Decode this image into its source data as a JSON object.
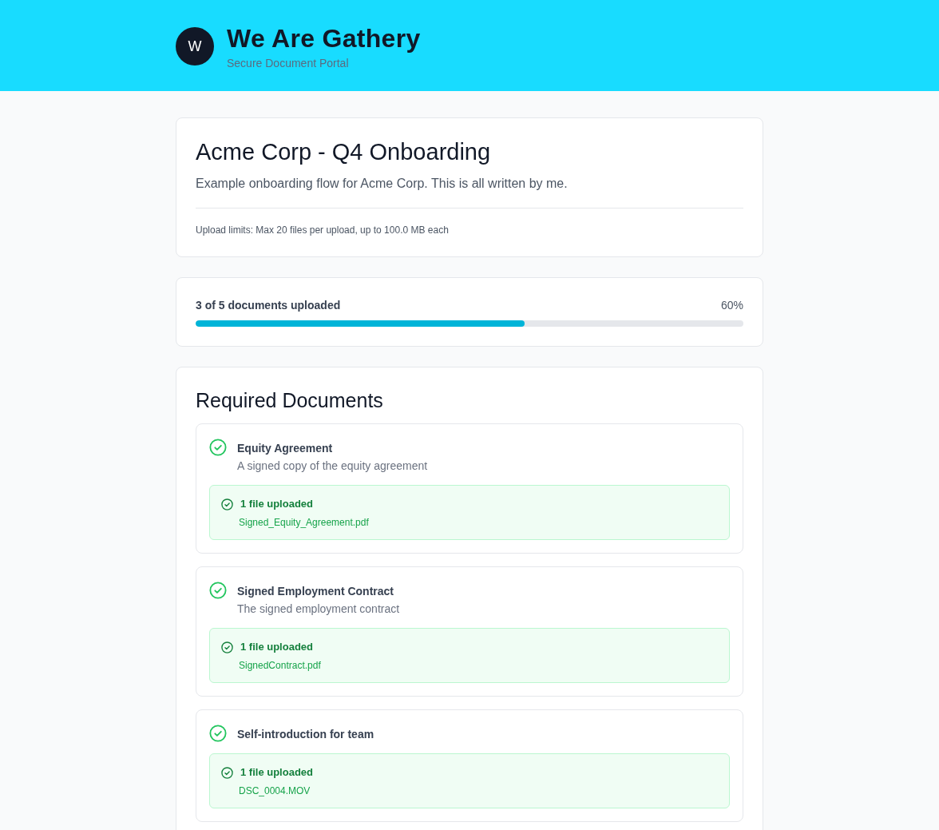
{
  "header": {
    "logo_letter": "W",
    "title": "We Are Gathery",
    "subtitle": "Secure Document Portal"
  },
  "project": {
    "title": "Acme Corp - Q4 Onboarding",
    "description": "Example onboarding flow for Acme Corp. This is all written by me.",
    "upload_limits": "Upload limits: Max 20 files per upload, up to 100.0 MB each"
  },
  "progress": {
    "label": "3 of 5 documents uploaded",
    "percent_text": "60%",
    "level": 0.6
  },
  "documents": {
    "heading": "Required Documents",
    "items": [
      {
        "title": "Equity Agreement",
        "description": "A signed copy of the equity agreement",
        "completed": true,
        "upload": {
          "status": "1 file uploaded",
          "filename": "Signed_Equity_Agreement.pdf"
        }
      },
      {
        "title": "Signed Employment Contract",
        "description": "The signed employment contract",
        "completed": true,
        "upload": {
          "status": "1 file uploaded",
          "filename": "SignedContract.pdf"
        }
      },
      {
        "title": "Self-introduction for team",
        "completed": true,
        "upload": {
          "status": "1 file uploaded",
          "filename": "DSC_0004.MOV"
        }
      }
    ]
  }
}
